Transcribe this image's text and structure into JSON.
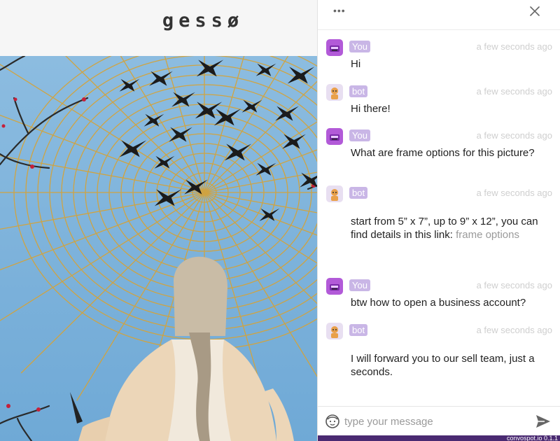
{
  "site": {
    "logo": "gessø"
  },
  "chat": {
    "more_label": "•••",
    "messages": [
      {
        "sender": "You",
        "type": "user",
        "time": "a few seconds ago",
        "text": "Hi"
      },
      {
        "sender": "bot",
        "type": "bot",
        "time": "a few seconds ago",
        "text": "Hi there!"
      },
      {
        "sender": "You",
        "type": "user",
        "time": "a few seconds ago",
        "text": "What are frame options for this picture?"
      },
      {
        "sender": "bot",
        "type": "bot",
        "time": "a few seconds ago",
        "text": "start from 5” x 7”, up to 9” x 12”, you can find details in this link: ",
        "link": "frame options"
      },
      {
        "sender": "You",
        "type": "user",
        "time": "a few seconds ago",
        "text": "btw how to open a business account?"
      },
      {
        "sender": "bot",
        "type": "bot",
        "time": "a few seconds ago",
        "text": "I will forward you to our sell team, just a seconds."
      }
    ],
    "input_placeholder": "type your message",
    "footer": "convospot.io 0.1.1"
  },
  "colors": {
    "badge": "#c9b6e6",
    "footer": "#4a2a72",
    "sky": "#7fb4d9",
    "web": "#d4a33a"
  }
}
